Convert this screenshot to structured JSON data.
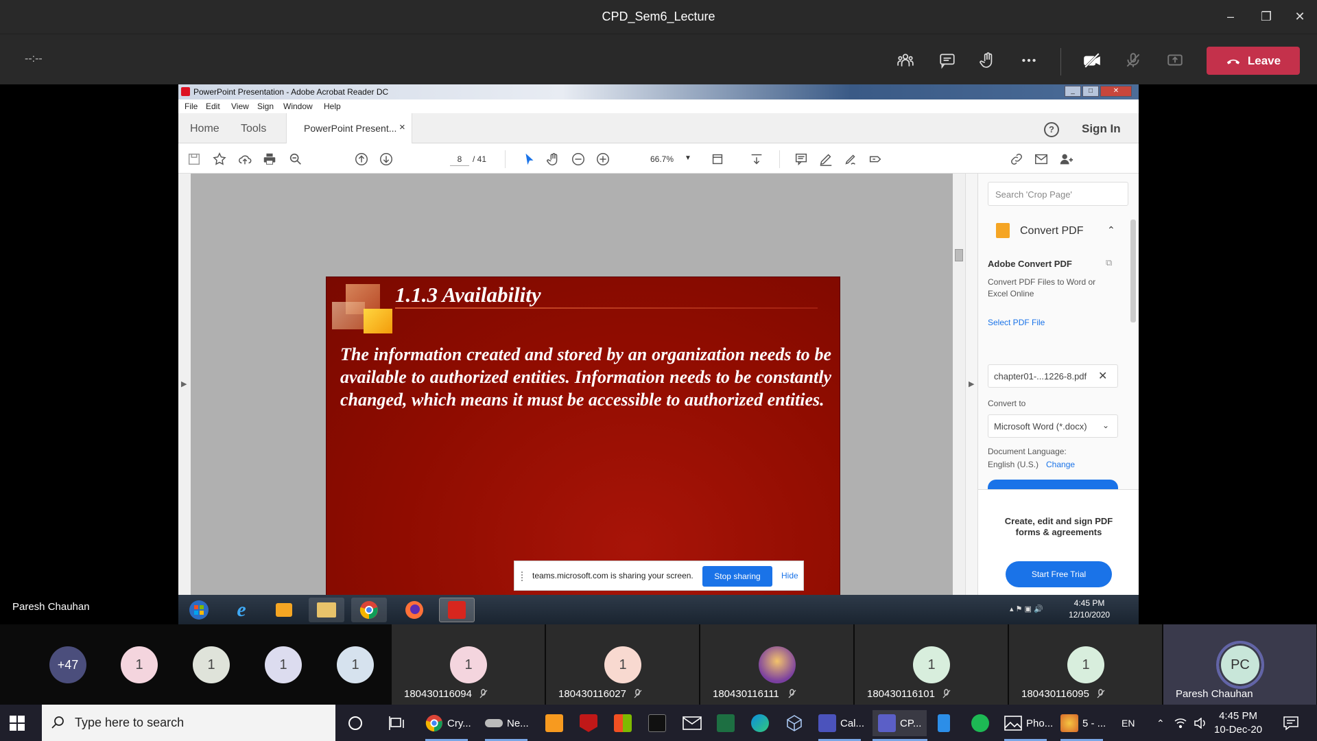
{
  "teams": {
    "window_title": "CPD_Sem6_Lecture",
    "timer": "--:--",
    "leave_label": "Leave",
    "presenter_name": "Paresh Chauhan",
    "icons": [
      "people-icon",
      "chat-icon",
      "raise-hand-icon",
      "more-icon",
      "camera-off-icon",
      "mic-off-icon",
      "share-tray-icon"
    ]
  },
  "acrobat": {
    "window_title": "PowerPoint Presentation - Adobe Acrobat Reader DC",
    "menu": [
      "File",
      "Edit",
      "View",
      "Sign",
      "Window",
      "Help"
    ],
    "tabs": {
      "home": "Home",
      "tools": "Tools",
      "doc": "PowerPoint Present...",
      "doc_close": "×"
    },
    "help": "?",
    "sign_in": "Sign In",
    "page_current": "8",
    "page_total": "/ 41",
    "zoom": "66.7%",
    "search_placeholder": "Search 'Crop Page'",
    "convert_header": "Convert PDF",
    "adobe_convert_title": "Adobe Convert PDF",
    "convert_desc": "Convert PDF Files to Word or Excel Online",
    "select_pdf_label": "Select PDF File",
    "selected_file": "chapter01-...1226-8.pdf",
    "convert_to_label": "Convert to",
    "convert_to_value": "Microsoft Word (*.docx)",
    "doc_lang_label": "Document Language:",
    "doc_lang_value": "English (U.S.)",
    "change_link": "Change",
    "promo": "Create, edit and sign PDF forms & agreements",
    "start_trial": "Start Free Trial"
  },
  "slide": {
    "title": "1.1.3  Availability",
    "body": "The information created and stored by an organization needs to be available to authorized entities. Information needs to be constantly changed, which means it must be accessible to authorized entities."
  },
  "share_notice": {
    "message": "teams.microsoft.com is sharing your screen.",
    "stop": "Stop sharing",
    "hide": "Hide"
  },
  "remote_taskbar": {
    "time": "4:45 PM",
    "date": "12/10/2020"
  },
  "participants": {
    "overflow": "+47",
    "small": [
      {
        "initial": "1",
        "color": "#f4d5de"
      },
      {
        "initial": "1",
        "color": "#dfe3da"
      },
      {
        "initial": "1",
        "color": "#dcdcef"
      },
      {
        "initial": "1",
        "color": "#d6e2ee"
      }
    ],
    "tiles": [
      {
        "id": "180430116094",
        "initial": "1",
        "color": "#f4d5de"
      },
      {
        "id": "180430116027",
        "initial": "1",
        "color": "#f8d9d0"
      },
      {
        "id": "180430116111",
        "initial": "",
        "color": "#b98a4a"
      },
      {
        "id": "180430116101",
        "initial": "1",
        "color": "#d8eedd"
      },
      {
        "id": "180430116095",
        "initial": "1",
        "color": "#d8eedd"
      }
    ],
    "self": {
      "initials": "PC",
      "name": "Paresh Chauhan",
      "color": "#c8e6d9"
    }
  },
  "taskbar": {
    "search_placeholder": "Type here to search",
    "apps": [
      "Cry...",
      "Ne...",
      "Cal...",
      "CP...",
      "Pho...",
      "5 - ..."
    ],
    "lang": "EN",
    "time": "4:45 PM",
    "date": "10-Dec-20"
  }
}
